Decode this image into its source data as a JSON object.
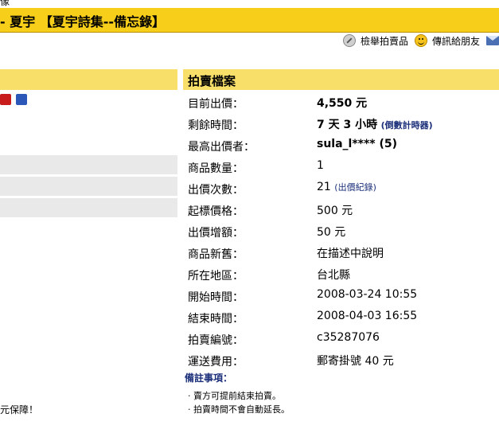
{
  "top_fragment": "像",
  "title": "- 夏宇 【夏宇詩集--備忘錄】",
  "actions": [
    {
      "label": "檢舉拍賣品",
      "icon": "report-icon"
    },
    {
      "label": "傳訊給朋友",
      "icon": "smile-icon"
    },
    {
      "label": "",
      "icon": "mail-icon"
    }
  ],
  "left": {
    "bottom_text": "元保障！"
  },
  "auction": {
    "header": "拍賣檔案",
    "rows": [
      {
        "label": "目前出價：",
        "value": "4,550 元",
        "value_bold": true
      },
      {
        "label": "剩餘時間：",
        "value": "7 天 3 小時",
        "value_bold": true,
        "extra": "(倒數計時器)"
      },
      {
        "label": "最高出價者：",
        "value": "sula_l**** (5)",
        "value_bold": true
      },
      {
        "label": "商品數量：",
        "value": "1"
      },
      {
        "label": "出價次數：",
        "value": "21",
        "extra": "(出價紀錄)"
      },
      {
        "label": "起標價格：",
        "value": "500 元"
      },
      {
        "label": "出價增額：",
        "value": "50 元"
      },
      {
        "label": "商品新舊：",
        "value": "在描述中說明"
      },
      {
        "label": "所在地區：",
        "value": "台北縣"
      },
      {
        "label": "開始時間：",
        "value": "2008-03-24 10:55"
      },
      {
        "label": "結束時間：",
        "value": "2008-04-03 16:55"
      },
      {
        "label": "拍賣編號：",
        "value": "c35287076"
      },
      {
        "label": "運送費用：",
        "value": "郵寄掛號 40 元"
      }
    ],
    "notes_title": "備註事項：",
    "notes": [
      "‧  賣方可提前結束拍賣。",
      "‧  拍賣時間不會自動延長。"
    ]
  }
}
